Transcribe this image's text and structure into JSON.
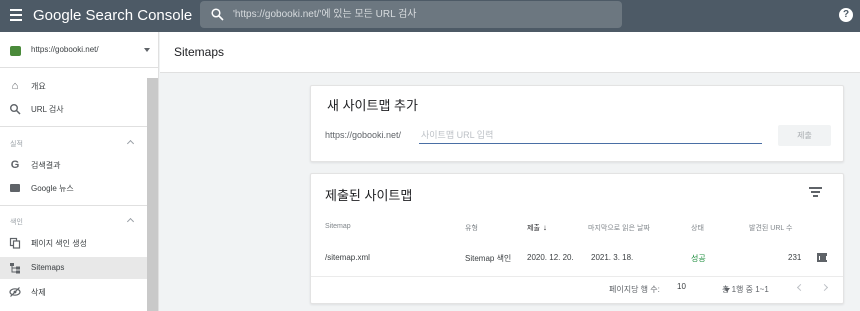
{
  "app": {
    "title": "Google Search Console"
  },
  "search": {
    "placeholder": "'https://gobooki.net/'에 있는 모든 URL 검사"
  },
  "help": {
    "glyph": "?"
  },
  "property": {
    "label": "https://gobooki.net/"
  },
  "sidebar": {
    "items": [
      {
        "label": "개요",
        "icon": "home-icon"
      },
      {
        "label": "URL 검사",
        "icon": "search-icon"
      }
    ],
    "sections": [
      {
        "label": "실적",
        "items": [
          {
            "label": "검색결과",
            "icon": "google-g-icon"
          },
          {
            "label": "Google 뉴스",
            "icon": "news-icon"
          }
        ]
      },
      {
        "label": "색인",
        "items": [
          {
            "label": "페이지 색인 생성",
            "icon": "copy-icon"
          },
          {
            "label": "Sitemaps",
            "icon": "sitemap-icon",
            "active": true
          },
          {
            "label": "삭제",
            "icon": "remove-icon"
          }
        ]
      }
    ]
  },
  "page": {
    "title": "Sitemaps"
  },
  "add_card": {
    "title": "새 사이트맵 추가",
    "prefix": "https://gobooki.net/",
    "input_placeholder": "사이트맵 URL 입력",
    "submit_label": "제출"
  },
  "submitted_card": {
    "title": "제출된 사이트맵",
    "columns": [
      "Sitemap",
      "유형",
      "제출",
      "마지막으로 읽은 날짜",
      "상태",
      "발견된 URL 수"
    ],
    "sort_glyph": "↓",
    "rows": [
      {
        "sitemap": "/sitemap.xml",
        "type": "Sitemap 색인",
        "submitted": "2020. 12. 20.",
        "last_read": "2021. 3. 18.",
        "status": "성공",
        "urls": "231"
      }
    ],
    "pagination": {
      "rows_per_page_label": "페이지당 행 수:",
      "rows_per_page": "10",
      "range": "총 1행 중 1~1"
    }
  },
  "colors": {
    "topbar": "#4d5a66",
    "success": "#1e8e3e",
    "input_underline": "#4a6fa5"
  }
}
